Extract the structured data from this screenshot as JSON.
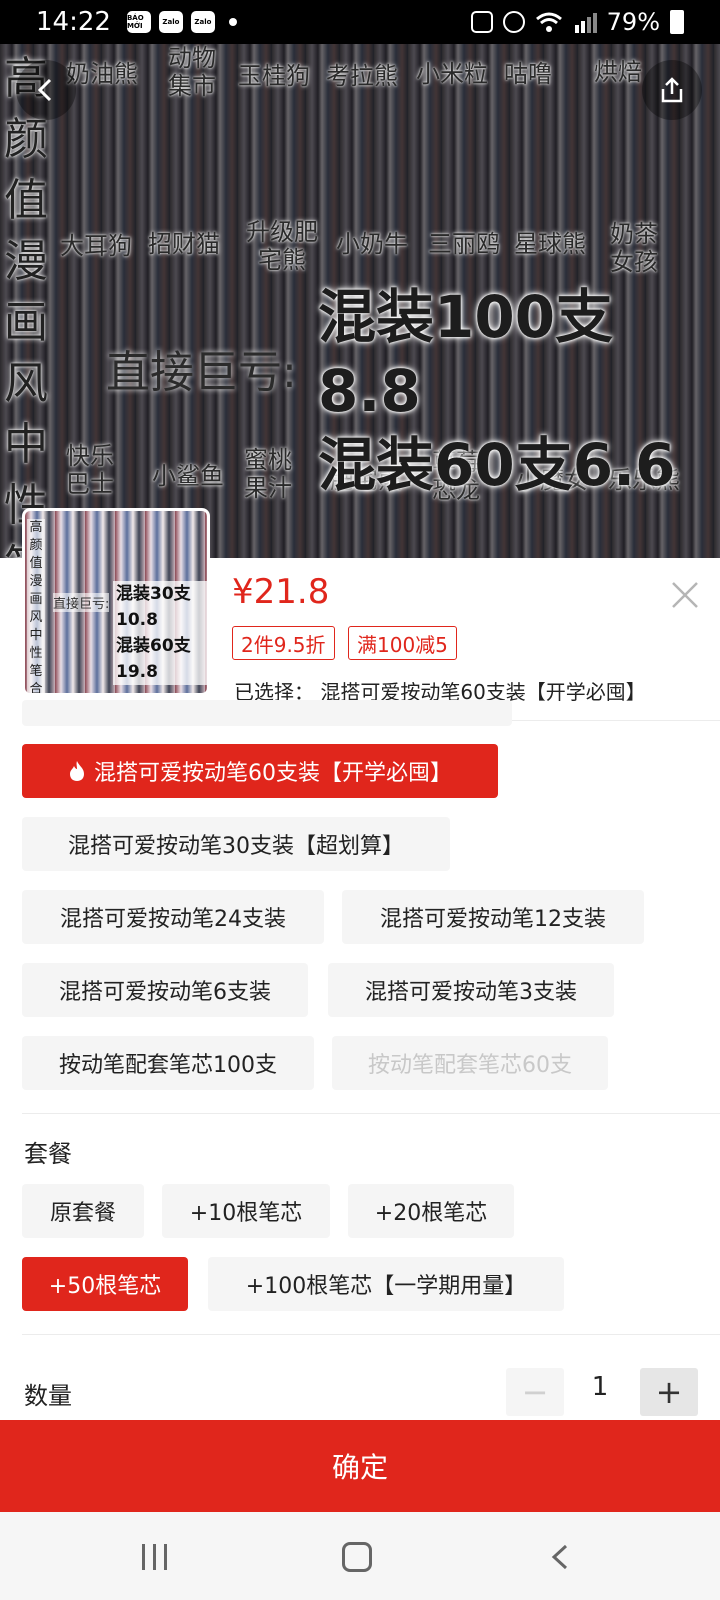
{
  "status_bar": {
    "time": "14:22",
    "apps": [
      "BÁO MỚI",
      "Zalo",
      "Zalo"
    ],
    "battery": "79%"
  },
  "hero": {
    "vertical_title": [
      "高",
      "颜",
      "值",
      "漫",
      "画",
      "风",
      "中",
      "性",
      "笔"
    ],
    "labels": [
      "奶油熊",
      "动物集市",
      "玉桂狗",
      "考拉熊",
      "小米粒",
      "咕噜",
      "烘焙",
      "大耳狗",
      "招财猫",
      "升级肥宅熊",
      "小奶牛",
      "三丽鸥",
      "星球熊",
      "奶茶女孩",
      "快乐巴士",
      "小鲨鱼",
      "蜜桃果汁",
      "肥宅熊",
      "草莓恐龙",
      "小魔女",
      "乐乐熊"
    ],
    "direct": "直接巨亏:",
    "big_line1": "混装100支8.8",
    "big_line2": "混装60支6.6"
  },
  "thumb": {
    "t1": "高颜值漫画风中性笔合集",
    "t2a": "混装30支10.8",
    "t2b": "混装60支19.8",
    "t3": "直接巨亏:"
  },
  "product": {
    "price": "¥21.8",
    "promo1": "2件9.5折",
    "promo2": "满100减5",
    "selected": "已选择：  混搭可爱按动笔60支装【开学必囤】"
  },
  "options": {
    "items": [
      "混搭可爱按动笔60支装【开学必囤】",
      "混搭可爱按动笔30支装【超划算】",
      "混搭可爱按动笔24支装",
      "混搭可爱按动笔12支装",
      "混搭可爱按动笔6支装",
      "混搭可爱按动笔3支装",
      "按动笔配套笔芯100支",
      "按动笔配套笔芯60支"
    ]
  },
  "package": {
    "title": "套餐",
    "items": [
      "原套餐",
      "+10根笔芯",
      "+20根笔芯",
      "+50根笔芯",
      "+100根笔芯【一学期用量】"
    ]
  },
  "quantity": {
    "label": "数量",
    "value": "1",
    "minus": "−",
    "plus": "+"
  },
  "confirm": "确定",
  "colors": {
    "accent": "#e0261c"
  },
  "icons": {
    "back": "chevron-left-icon",
    "share": "share-icon",
    "close": "close-icon",
    "hot": "flame-icon"
  }
}
